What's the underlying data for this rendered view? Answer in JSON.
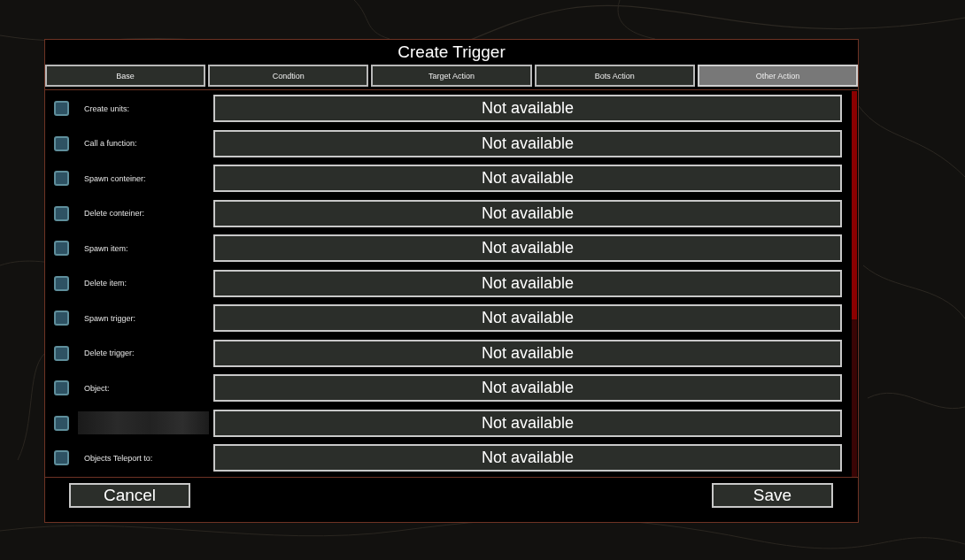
{
  "dialog": {
    "title": "Create Trigger"
  },
  "tabs": [
    {
      "label": "Base",
      "selected": false
    },
    {
      "label": "Condtion",
      "selected": false
    },
    {
      "label": "Target Action",
      "selected": false
    },
    {
      "label": "Bots Action",
      "selected": false
    },
    {
      "label": "Other Action",
      "selected": true
    }
  ],
  "rows": [
    {
      "kind": "labeled",
      "label": "Create units:",
      "checked": false,
      "value": "Not available"
    },
    {
      "kind": "labeled",
      "label": "Call a function:",
      "checked": false,
      "value": "Not available"
    },
    {
      "kind": "labeled",
      "label": "Spawn conteiner:",
      "checked": false,
      "value": "Not available"
    },
    {
      "kind": "labeled",
      "label": "Delete conteiner:",
      "checked": false,
      "value": "Not available"
    },
    {
      "kind": "labeled",
      "label": "Spawn item:",
      "checked": false,
      "value": "Not available"
    },
    {
      "kind": "labeled",
      "label": "Delete item:",
      "checked": false,
      "value": "Not available"
    },
    {
      "kind": "labeled",
      "label": "Spawn trigger:",
      "checked": false,
      "value": "Not available"
    },
    {
      "kind": "labeled",
      "label": "Delete trigger:",
      "checked": false,
      "value": "Not available"
    },
    {
      "kind": "labeled",
      "label": "Object:",
      "checked": false,
      "value": "Not available"
    },
    {
      "kind": "redacted",
      "checked": false,
      "value": "Not available"
    },
    {
      "kind": "labeled",
      "label": "Objects Teleport to:",
      "checked": false,
      "value": "Not available"
    }
  ],
  "buttons": [
    "Cancel",
    "Save"
  ]
}
